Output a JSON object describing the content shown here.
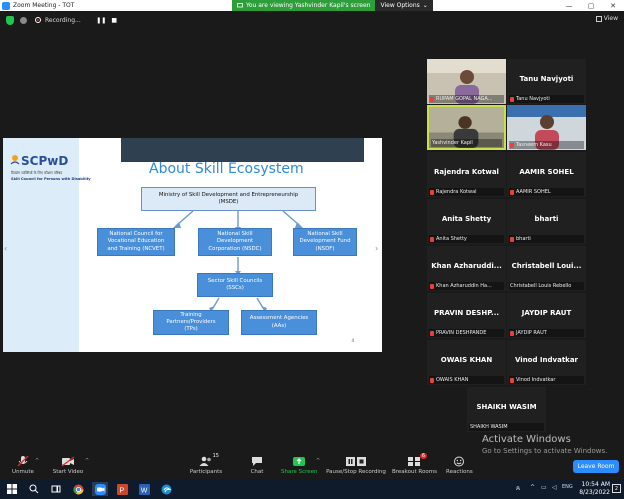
{
  "window": {
    "title": "Zoom Meeting - TOT"
  },
  "window_controls": {
    "minimize": "—",
    "maximize": "▢",
    "close": "✕"
  },
  "share_banner": {
    "message": "You are viewing Yashvinder Kapil's screen",
    "options_label": "View Options"
  },
  "recording": {
    "label": "Recording...",
    "pause": "❚❚",
    "stop": "■"
  },
  "view_button": {
    "label": "View"
  },
  "slide": {
    "logo_text": "SCPwD",
    "logo_hindi": "दिव्यांग व्यक्तियों के लिए कौशल परिषद",
    "logo_english": "Skill Council for Persons with Disability",
    "title": "About Skill Ecosystem",
    "msde": "Ministry of Skill Development and Entrepreneurship\n(MSDE)",
    "ncvet": "National Council for\nVocational Education\nand Training (NCVET)",
    "nsdc": "National Skill\nDevelopment\nCorporation (NSDC)",
    "nsdf": "National Skill\nDevelopment Fund\n(NSDF)",
    "ssc": "Sector Skill Councils\n(SSCs)",
    "tp": "Training\nPartners/Providers\n(TPs)",
    "aa": "Assessment Agencies\n(AAs)",
    "page_number": "4"
  },
  "participants": [
    {
      "big": "",
      "name": "RUPAM GOPAL NAGA...",
      "video": true
    },
    {
      "big": "Tanu Navjyoti",
      "name": "Tanu Navjyoti",
      "video": false
    },
    {
      "big": "",
      "name": "Yashvinder Kapil",
      "video": true,
      "active": true
    },
    {
      "big": "",
      "name": "Tasneem Kasu",
      "video": true
    },
    {
      "big": "Rajendra Kotwal",
      "name": "Rajendra Kotwal",
      "video": false
    },
    {
      "big": "AAMIR SOHEL",
      "name": "AAMIR SOHEL",
      "video": false
    },
    {
      "big": "Anita Shetty",
      "name": "Anita Shetty",
      "video": false
    },
    {
      "big": "bharti",
      "name": "bharti",
      "video": false
    },
    {
      "big": "Khan  Azharuddi...",
      "name": "Khan Azharuddin  Ha...",
      "video": false
    },
    {
      "big": "Christabell  Loui...",
      "name": "Christabell Louis Rebello",
      "video": false
    },
    {
      "big": "PRAVIN  DESHP...",
      "name": "PRAVIN DESHPANDE",
      "video": false
    },
    {
      "big": "JAYDIP RAUT",
      "name": "JAYDIP RAUT",
      "video": false
    },
    {
      "big": "OWAIS KHAN",
      "name": "OWAIS KHAN",
      "video": false
    },
    {
      "big": "Vinod Indvatkar",
      "name": "Vinod Indvatkar",
      "video": false
    },
    {
      "big": "SHAIKH WASIM",
      "name": "SHAIKH WASIM",
      "video": false
    }
  ],
  "watermark": {
    "line1": "Activate Windows",
    "line2": "Go to Settings to activate Windows."
  },
  "leave_button": {
    "label": "Leave Room"
  },
  "toolbar": {
    "unmute": "Unmute",
    "start_video": "Start Video",
    "participants": "Participants",
    "participants_count": "15",
    "chat": "Chat",
    "share_screen": "Share Screen",
    "pause_recording": "Pause/Stop Recording",
    "breakout_rooms": "Breakout Rooms",
    "breakout_badge": "6",
    "reactions": "Reactions"
  },
  "taskbar": {
    "time": "10:54 AM",
    "date": "8/23/2022",
    "lang": "ENG",
    "notif_count": "2"
  },
  "colors": {
    "share_green": "#23c552",
    "zoom_blue": "#2d8cff",
    "mute_red": "#e8413b",
    "slide_blue": "#4a8fd9"
  }
}
